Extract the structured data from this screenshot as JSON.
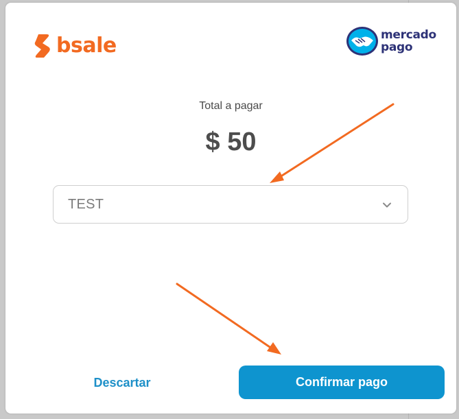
{
  "brand": {
    "bsale_name": "bsale",
    "mercadopago_line1": "mercado",
    "mercadopago_line2": "pago"
  },
  "payment": {
    "total_label": "Total a pagar",
    "total_amount": "$ 50"
  },
  "terminal_select": {
    "selected_value": "TEST"
  },
  "actions": {
    "discard_label": "Descartar",
    "confirm_label": "Confirmar pago"
  },
  "colors": {
    "bsale_orange": "#f26a21",
    "primary_blue": "#0e94cf",
    "link_blue": "#1e90c8",
    "mercadopago_navy": "#2d3277",
    "annotation_arrow": "#f26a21"
  }
}
